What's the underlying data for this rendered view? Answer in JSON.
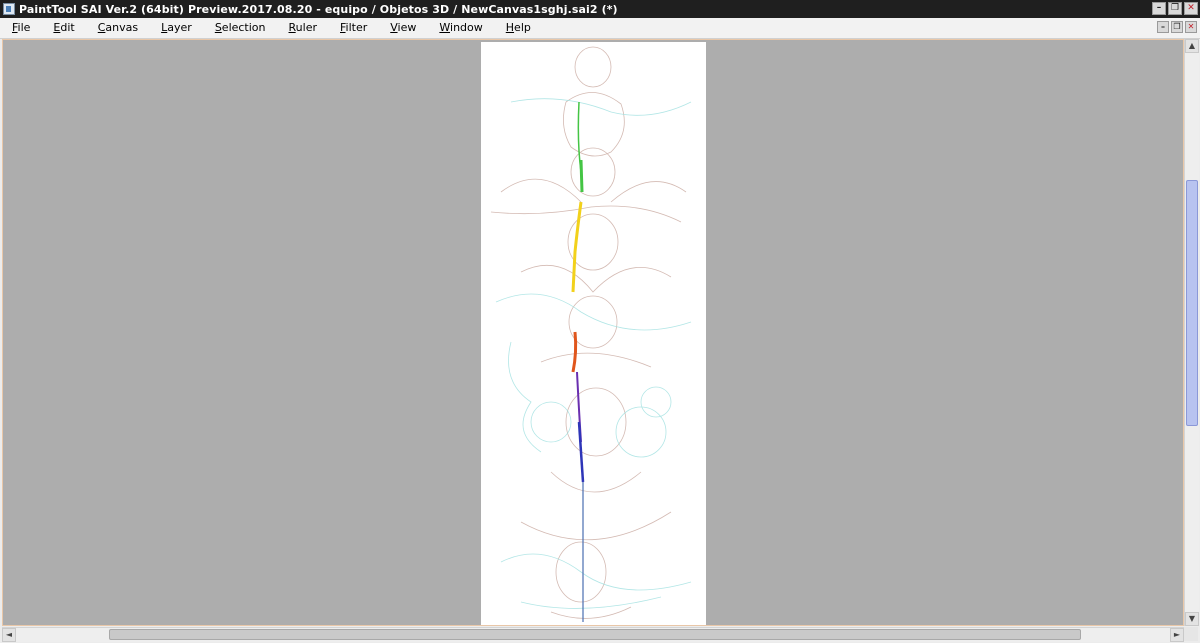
{
  "window": {
    "title": "PaintTool SAI Ver.2 (64bit) Preview.2017.08.20 - equipo / Objetos 3D / NewCanvas1sghj.sai2 (*)",
    "minimize_glyph": "–",
    "restore_glyph": "❐",
    "close_glyph": "✕"
  },
  "menubar": {
    "items": [
      {
        "label": "File",
        "accel": "F",
        "rest": "ile"
      },
      {
        "label": "Edit",
        "accel": "E",
        "rest": "dit"
      },
      {
        "label": "Canvas",
        "accel": "C",
        "rest": "anvas"
      },
      {
        "label": "Layer",
        "accel": "L",
        "rest": "ayer"
      },
      {
        "label": "Selection",
        "accel": "S",
        "rest": "election"
      },
      {
        "label": "Ruler",
        "accel": "R",
        "rest": "uler"
      },
      {
        "label": "Filter",
        "accel": "F",
        "rest": "ilter"
      },
      {
        "label": "View",
        "accel": "V",
        "rest": "iew"
      },
      {
        "label": "Window",
        "accel": "W",
        "rest": "indow"
      },
      {
        "label": "Help",
        "accel": "H",
        "rest": "elp"
      }
    ]
  },
  "canvas": {
    "background": "#ffffff",
    "workspace_bg": "#adadad",
    "stroke_colors": [
      "#44c544",
      "#f2d11b",
      "#e0561c",
      "#3a2fb8",
      "#4a6fb0"
    ]
  },
  "scrollbars": {
    "up_glyph": "▲",
    "down_glyph": "▼",
    "left_glyph": "◄",
    "right_glyph": "►"
  }
}
